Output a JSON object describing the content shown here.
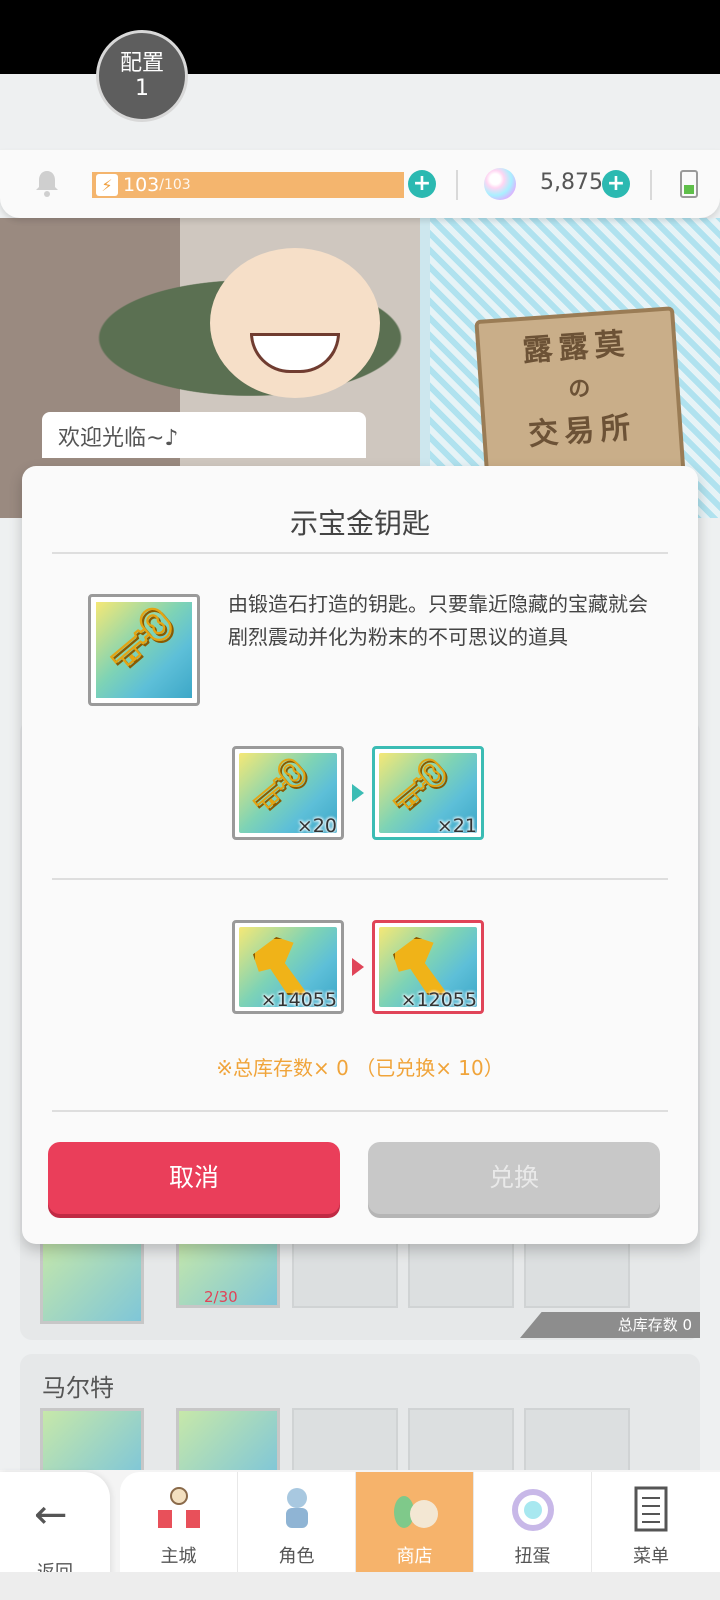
{
  "config": {
    "label": "配置",
    "number": "1"
  },
  "status": {
    "stamina_value": "103",
    "stamina_max": "/103",
    "gems": "5,875"
  },
  "scene": {
    "sign_line1": "露露莫",
    "sign_line2": "の",
    "sign_line3": "交易所",
    "welcome": "欢迎光临~♪"
  },
  "dialog": {
    "title": "示宝金钥匙",
    "description": "由锻造石打造的钥匙。只要靠近隐藏的宝藏就会剧烈震动并化为粉末的不可思议的道具",
    "key_before_qty": "×20",
    "key_after_qty": "×21",
    "ticket_before_qty": "×14055",
    "ticket_after_qty": "×12055",
    "note": "※总库存数× 0 （已兑换× 10）",
    "cancel_label": "取消",
    "exchange_label": "兑换"
  },
  "background": {
    "progress": "2/30",
    "stock_tag": "总库存数 0",
    "section_title": "马尔特"
  },
  "nav": {
    "back": "返回",
    "items": [
      {
        "label": "主城",
        "icon": "castle-icon"
      },
      {
        "label": "角色",
        "icon": "character-icon"
      },
      {
        "label": "商店",
        "icon": "shop-icon"
      },
      {
        "label": "扭蛋",
        "icon": "gacha-icon"
      },
      {
        "label": "菜单",
        "icon": "menu-icon"
      }
    ],
    "active_index": 2
  },
  "colors": {
    "accent_teal": "#3bbcb4",
    "cancel_red": "#ea3e5a",
    "stamina_orange": "#f4b56e",
    "note_orange": "#f0a43a",
    "nav_active": "#f6b36b"
  }
}
